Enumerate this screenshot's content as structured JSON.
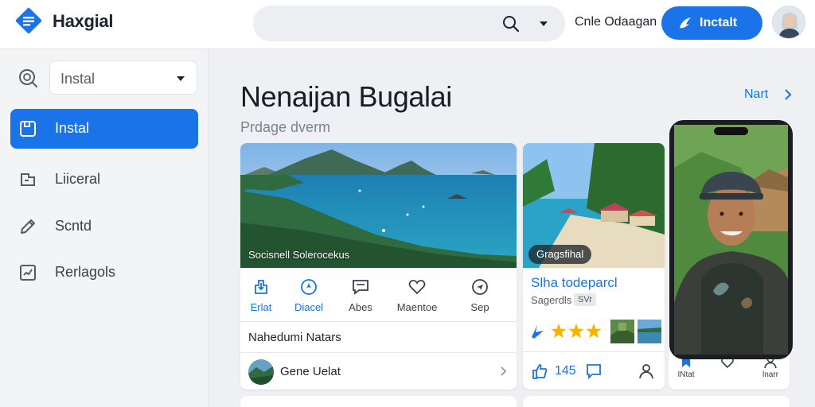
{
  "header": {
    "app_name": "Haxgial",
    "user_name": "Cnle Odaagan",
    "install_label": "Inctalt",
    "icons": [
      "app-logo-icon",
      "search-icon",
      "chevron-down-icon",
      "bolt-icon",
      "user-avatar"
    ]
  },
  "sidebar": {
    "select_value": "Instal",
    "items": [
      {
        "label": "Instal",
        "icon": "save-icon",
        "active": true
      },
      {
        "label": "Liiceral",
        "icon": "folder-icon",
        "active": false
      },
      {
        "label": "Scntd",
        "icon": "edit-icon",
        "active": false
      },
      {
        "label": "Rerlagols",
        "icon": "chart-icon",
        "active": false
      }
    ]
  },
  "main": {
    "title": "Nenaijan Bugalai",
    "subtitle": "Prdage dverm",
    "next_label": "Nart",
    "card1": {
      "caption": "Socisnell Solerocekus",
      "actions": [
        {
          "label": "Erlat",
          "icon": "share-icon"
        },
        {
          "label": "Diacel",
          "icon": "compass-icon"
        },
        {
          "label": "Abes",
          "icon": "comment-icon"
        },
        {
          "label": "Maentoe",
          "icon": "heart-icon"
        },
        {
          "label": "Sep",
          "icon": "send-icon"
        }
      ],
      "section_title": "Nahedumi Natars",
      "list_item": "Gene Uelat"
    },
    "card2": {
      "tag": "Gragsfihal",
      "title": "Slha todeparcl",
      "subtitle": "Sagerdls",
      "badge": "SVr",
      "stars": 3,
      "count": "145"
    },
    "card3": {
      "actions": [
        {
          "label": "INtat",
          "icon": "bookmark-icon"
        },
        {
          "label": "",
          "icon": "heart-icon"
        },
        {
          "label": "lnarr",
          "icon": "person-icon"
        }
      ]
    }
  },
  "colors": {
    "accent": "#1a73e8",
    "background": "#eef0f3",
    "star": "#f4b400"
  }
}
